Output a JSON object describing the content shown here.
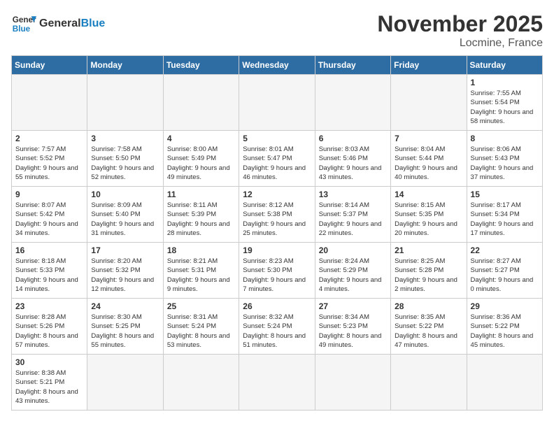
{
  "logo": {
    "text_general": "General",
    "text_blue": "Blue"
  },
  "title": "November 2025",
  "location": "Locmine, France",
  "weekdays": [
    "Sunday",
    "Monday",
    "Tuesday",
    "Wednesday",
    "Thursday",
    "Friday",
    "Saturday"
  ],
  "weeks": [
    [
      {
        "day": "",
        "info": ""
      },
      {
        "day": "",
        "info": ""
      },
      {
        "day": "",
        "info": ""
      },
      {
        "day": "",
        "info": ""
      },
      {
        "day": "",
        "info": ""
      },
      {
        "day": "",
        "info": ""
      },
      {
        "day": "1",
        "info": "Sunrise: 7:55 AM\nSunset: 5:54 PM\nDaylight: 9 hours and 58 minutes."
      }
    ],
    [
      {
        "day": "2",
        "info": "Sunrise: 7:57 AM\nSunset: 5:52 PM\nDaylight: 9 hours and 55 minutes."
      },
      {
        "day": "3",
        "info": "Sunrise: 7:58 AM\nSunset: 5:50 PM\nDaylight: 9 hours and 52 minutes."
      },
      {
        "day": "4",
        "info": "Sunrise: 8:00 AM\nSunset: 5:49 PM\nDaylight: 9 hours and 49 minutes."
      },
      {
        "day": "5",
        "info": "Sunrise: 8:01 AM\nSunset: 5:47 PM\nDaylight: 9 hours and 46 minutes."
      },
      {
        "day": "6",
        "info": "Sunrise: 8:03 AM\nSunset: 5:46 PM\nDaylight: 9 hours and 43 minutes."
      },
      {
        "day": "7",
        "info": "Sunrise: 8:04 AM\nSunset: 5:44 PM\nDaylight: 9 hours and 40 minutes."
      },
      {
        "day": "8",
        "info": "Sunrise: 8:06 AM\nSunset: 5:43 PM\nDaylight: 9 hours and 37 minutes."
      }
    ],
    [
      {
        "day": "9",
        "info": "Sunrise: 8:07 AM\nSunset: 5:42 PM\nDaylight: 9 hours and 34 minutes."
      },
      {
        "day": "10",
        "info": "Sunrise: 8:09 AM\nSunset: 5:40 PM\nDaylight: 9 hours and 31 minutes."
      },
      {
        "day": "11",
        "info": "Sunrise: 8:11 AM\nSunset: 5:39 PM\nDaylight: 9 hours and 28 minutes."
      },
      {
        "day": "12",
        "info": "Sunrise: 8:12 AM\nSunset: 5:38 PM\nDaylight: 9 hours and 25 minutes."
      },
      {
        "day": "13",
        "info": "Sunrise: 8:14 AM\nSunset: 5:37 PM\nDaylight: 9 hours and 22 minutes."
      },
      {
        "day": "14",
        "info": "Sunrise: 8:15 AM\nSunset: 5:35 PM\nDaylight: 9 hours and 20 minutes."
      },
      {
        "day": "15",
        "info": "Sunrise: 8:17 AM\nSunset: 5:34 PM\nDaylight: 9 hours and 17 minutes."
      }
    ],
    [
      {
        "day": "16",
        "info": "Sunrise: 8:18 AM\nSunset: 5:33 PM\nDaylight: 9 hours and 14 minutes."
      },
      {
        "day": "17",
        "info": "Sunrise: 8:20 AM\nSunset: 5:32 PM\nDaylight: 9 hours and 12 minutes."
      },
      {
        "day": "18",
        "info": "Sunrise: 8:21 AM\nSunset: 5:31 PM\nDaylight: 9 hours and 9 minutes."
      },
      {
        "day": "19",
        "info": "Sunrise: 8:23 AM\nSunset: 5:30 PM\nDaylight: 9 hours and 7 minutes."
      },
      {
        "day": "20",
        "info": "Sunrise: 8:24 AM\nSunset: 5:29 PM\nDaylight: 9 hours and 4 minutes."
      },
      {
        "day": "21",
        "info": "Sunrise: 8:25 AM\nSunset: 5:28 PM\nDaylight: 9 hours and 2 minutes."
      },
      {
        "day": "22",
        "info": "Sunrise: 8:27 AM\nSunset: 5:27 PM\nDaylight: 9 hours and 0 minutes."
      }
    ],
    [
      {
        "day": "23",
        "info": "Sunrise: 8:28 AM\nSunset: 5:26 PM\nDaylight: 8 hours and 57 minutes."
      },
      {
        "day": "24",
        "info": "Sunrise: 8:30 AM\nSunset: 5:25 PM\nDaylight: 8 hours and 55 minutes."
      },
      {
        "day": "25",
        "info": "Sunrise: 8:31 AM\nSunset: 5:24 PM\nDaylight: 8 hours and 53 minutes."
      },
      {
        "day": "26",
        "info": "Sunrise: 8:32 AM\nSunset: 5:24 PM\nDaylight: 8 hours and 51 minutes."
      },
      {
        "day": "27",
        "info": "Sunrise: 8:34 AM\nSunset: 5:23 PM\nDaylight: 8 hours and 49 minutes."
      },
      {
        "day": "28",
        "info": "Sunrise: 8:35 AM\nSunset: 5:22 PM\nDaylight: 8 hours and 47 minutes."
      },
      {
        "day": "29",
        "info": "Sunrise: 8:36 AM\nSunset: 5:22 PM\nDaylight: 8 hours and 45 minutes."
      }
    ],
    [
      {
        "day": "30",
        "info": "Sunrise: 8:38 AM\nSunset: 5:21 PM\nDaylight: 8 hours and 43 minutes."
      },
      {
        "day": "",
        "info": ""
      },
      {
        "day": "",
        "info": ""
      },
      {
        "day": "",
        "info": ""
      },
      {
        "day": "",
        "info": ""
      },
      {
        "day": "",
        "info": ""
      },
      {
        "day": "",
        "info": ""
      }
    ]
  ]
}
